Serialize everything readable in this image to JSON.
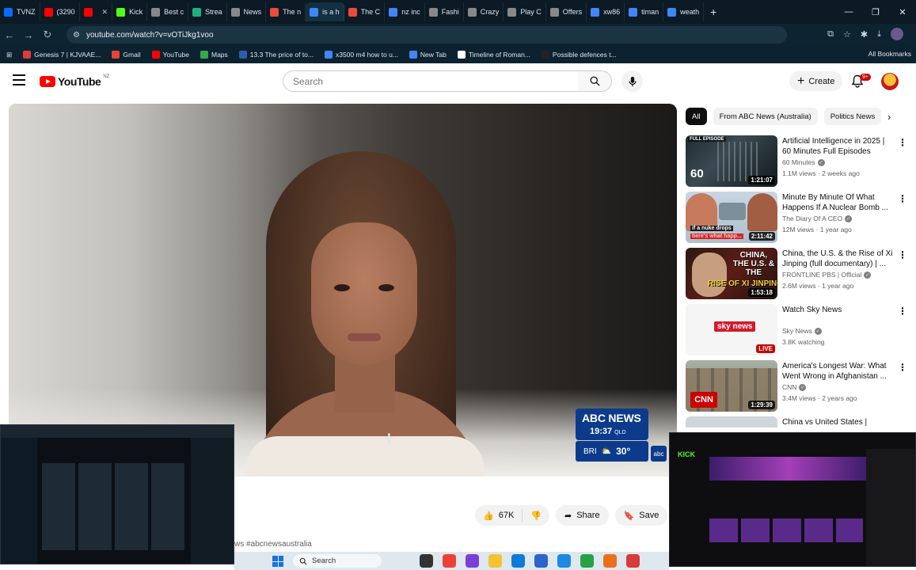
{
  "browser": {
    "tabs": [
      {
        "label": "TVNZ",
        "color": "#0a6cff"
      },
      {
        "label": "(3290",
        "color": "#ff0000"
      },
      {
        "label": "",
        "color": "#ff0000"
      },
      {
        "label": "Kick",
        "color": "#53fc18"
      },
      {
        "label": "Best c",
        "color": "#888888"
      },
      {
        "label": "Strea",
        "color": "#1fb07c"
      },
      {
        "label": "News",
        "color": "#888888"
      },
      {
        "label": "The n",
        "color": "#e94b3c"
      },
      {
        "label": "is a h",
        "color": "#4285f4"
      },
      {
        "label": "The C",
        "color": "#e94b3c"
      },
      {
        "label": "nz inc",
        "color": "#4285f4"
      },
      {
        "label": "Fashi",
        "color": "#888888"
      },
      {
        "label": "Crazy",
        "color": "#888888"
      },
      {
        "label": "Play C",
        "color": "#888888"
      },
      {
        "label": "Offers",
        "color": "#888888"
      },
      {
        "label": "xw86",
        "color": "#4285f4"
      },
      {
        "label": "timan",
        "color": "#4285f4"
      },
      {
        "label": "weath",
        "color": "#4285f4"
      }
    ],
    "new_tab": "+",
    "window_controls": {
      "minimize": "—",
      "maximize": "❐",
      "close": "✕"
    },
    "url": "youtube.com/watch?v=vOTiJkg1voo",
    "bookmarks": [
      {
        "label": "Genesis 7 | KJVAAE...",
        "color": "#e53935"
      },
      {
        "label": "Gmail",
        "color": "#ea4335"
      },
      {
        "label": "YouTube",
        "color": "#ff0000"
      },
      {
        "label": "Maps",
        "color": "#34a853"
      },
      {
        "label": "13.3 The price of to...",
        "color": "#2b5ea7"
      },
      {
        "label": "x3500 m4 how to u...",
        "color": "#4285f4"
      },
      {
        "label": "New Tab",
        "color": "#4285f4"
      },
      {
        "label": "Timeline of Roman...",
        "color": "#ffffff"
      },
      {
        "label": "Possible defences t...",
        "color": "#222222"
      }
    ],
    "all_bookmarks": "All Bookmarks"
  },
  "youtube": {
    "logo": "YouTube",
    "region": "NZ",
    "search_placeholder": "Search",
    "create_label": "Create",
    "notification_count": "9+",
    "chips": [
      "All",
      "From ABC News (Australia)",
      "Politics News"
    ],
    "chip_next": "›",
    "actions": {
      "likes": "67K",
      "share": "Share",
      "save": "Save"
    },
    "hashtags": "ws #abcnewsaustralia"
  },
  "player": {
    "overlay_brand": "ABC NEWS",
    "overlay_time": "19:37",
    "overlay_tz": "QLD",
    "overlay_city": "BRI",
    "overlay_temp": "30°"
  },
  "recommendations": [
    {
      "title": "Artificial Intelligence in 2025 | 60 Minutes Full Episodes",
      "channel": "60 Minutes",
      "meta": "1.1M views · 2 weeks ago",
      "duration": "1:21:07",
      "tag": "FULL EPISODE",
      "thumb_text": "60"
    },
    {
      "title": "Minute By Minute Of What Happens If A Nuclear Bomb ...",
      "channel": "The Diary Of A CEO",
      "meta": "12M views · 1 year ago",
      "duration": "2:11:42",
      "thumb_text": "if a nuke drops",
      "thumb_text2": "here's what happ..."
    },
    {
      "title": "China, the U.S. & the Rise of Xi Jinping (full documentary) | ...",
      "channel": "FRONTLINE PBS | Official",
      "meta": "2.6M views · 1 year ago",
      "duration": "1:53:18",
      "thumb_text": "CHINA, THE U.S. & THE",
      "thumb_text2": "RISE OF XI JINPING"
    },
    {
      "title": "Watch Sky News",
      "channel": "Sky News",
      "meta": "3.8K watching",
      "live": "LIVE",
      "thumb_text": "sky news"
    },
    {
      "title": "America's Longest War: What Went Wrong in Afghanistan ...",
      "channel": "CNN",
      "meta": "3.4M views · 2 years ago",
      "duration": "1:29:39",
      "thumb_text": "CNN"
    },
    {
      "title": "China vs United States | Behind the Military Build-Up"
    }
  ],
  "taskbar": {
    "search_label": "Search"
  }
}
